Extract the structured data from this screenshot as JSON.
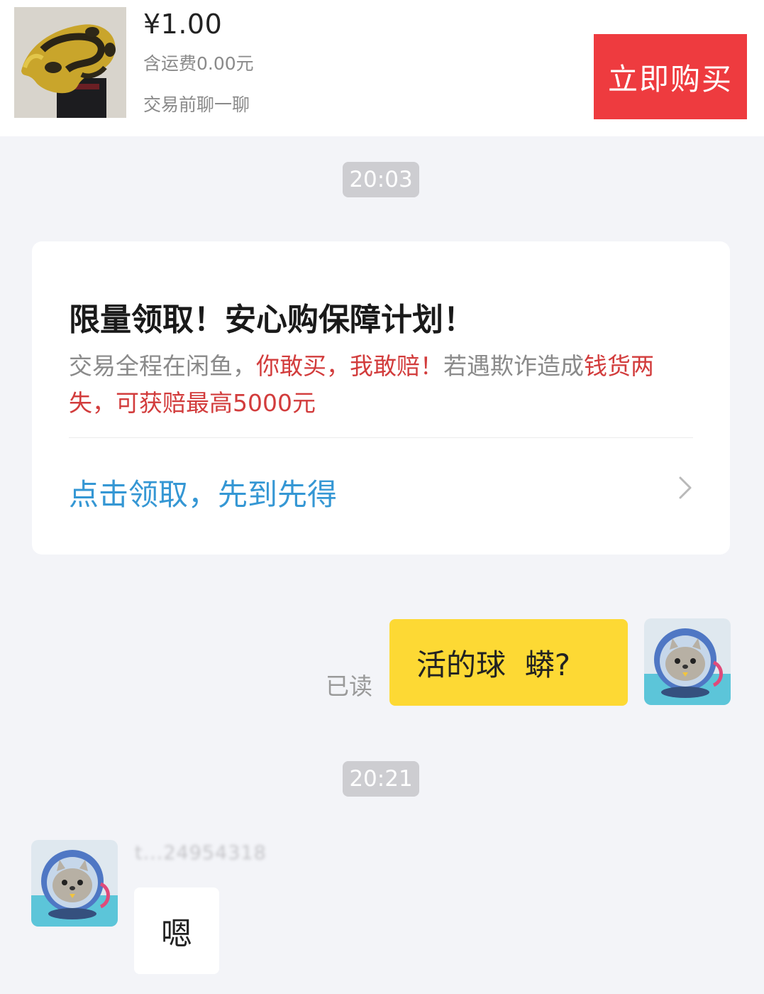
{
  "product": {
    "price": "¥1.00",
    "shipping": "含运费0.00元",
    "chat_prompt": "交易前聊一聊",
    "buy_label": "立即购买",
    "thumbnail": "ball-python-photo"
  },
  "colors": {
    "buy_button": "#ee3b3f",
    "promo_red": "#d23c3c",
    "link_blue": "#3597d4",
    "sent_bubble": "#fdd934",
    "background": "#f3f4f8"
  },
  "timestamps": [
    "20:03",
    "20:21"
  ],
  "promo": {
    "title": "限量领取！安心购保障计划！",
    "desc": {
      "part1": "交易全程在闲鱼，",
      "part2": "你敢买，我敢赔！",
      "part3": "若遇欺诈造成",
      "part4": "钱货两失，可获赔最高5000元"
    },
    "link": "点击领取，先到先得",
    "link_icon": "chevron-right-icon"
  },
  "messages": {
    "sent": {
      "text": "活的球  蟒?",
      "status": "已读",
      "avatar": "seal-astronaut-avatar"
    },
    "received": {
      "sender": "t...24954318",
      "text": "嗯",
      "avatar": "seal-astronaut-avatar"
    }
  }
}
